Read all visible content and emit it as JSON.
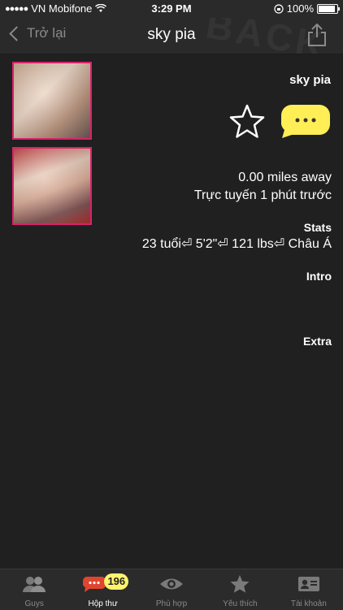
{
  "status_bar": {
    "signal": "●●●●●",
    "carrier": "VN Mobifone",
    "time": "3:29 PM",
    "battery": "100%"
  },
  "nav": {
    "back_label": "Trở lại",
    "title": "sky pia",
    "watermark": "BACK"
  },
  "profile": {
    "name": "sky pia",
    "distance": "0.00 miles away",
    "online": "Trực tuyến 1 phút trước",
    "stats_label": "Stats",
    "stats_values": "23 tuổi⏎ 5'2\"⏎ 121 lbs⏎ Châu Á",
    "intro_label": "Intro",
    "extra_label": "Extra"
  },
  "tabs": [
    {
      "label": "Guys",
      "icon": "guys-icon",
      "active": false
    },
    {
      "label": "Hộp thư",
      "icon": "inbox-icon",
      "active": true,
      "badge": "196"
    },
    {
      "label": "Phù hợp",
      "icon": "eye-icon",
      "active": false
    },
    {
      "label": "Yêu thích",
      "icon": "star-icon",
      "active": false
    },
    {
      "label": "Tài khoản",
      "icon": "account-card-icon",
      "active": false
    }
  ],
  "colors": {
    "background": "#202020",
    "bar": "#2a2a2a",
    "photo_border": "#d8226b",
    "message_bubble": "#ffee55",
    "badge": "#fff36d",
    "inbox_icon": "#e0452f"
  }
}
